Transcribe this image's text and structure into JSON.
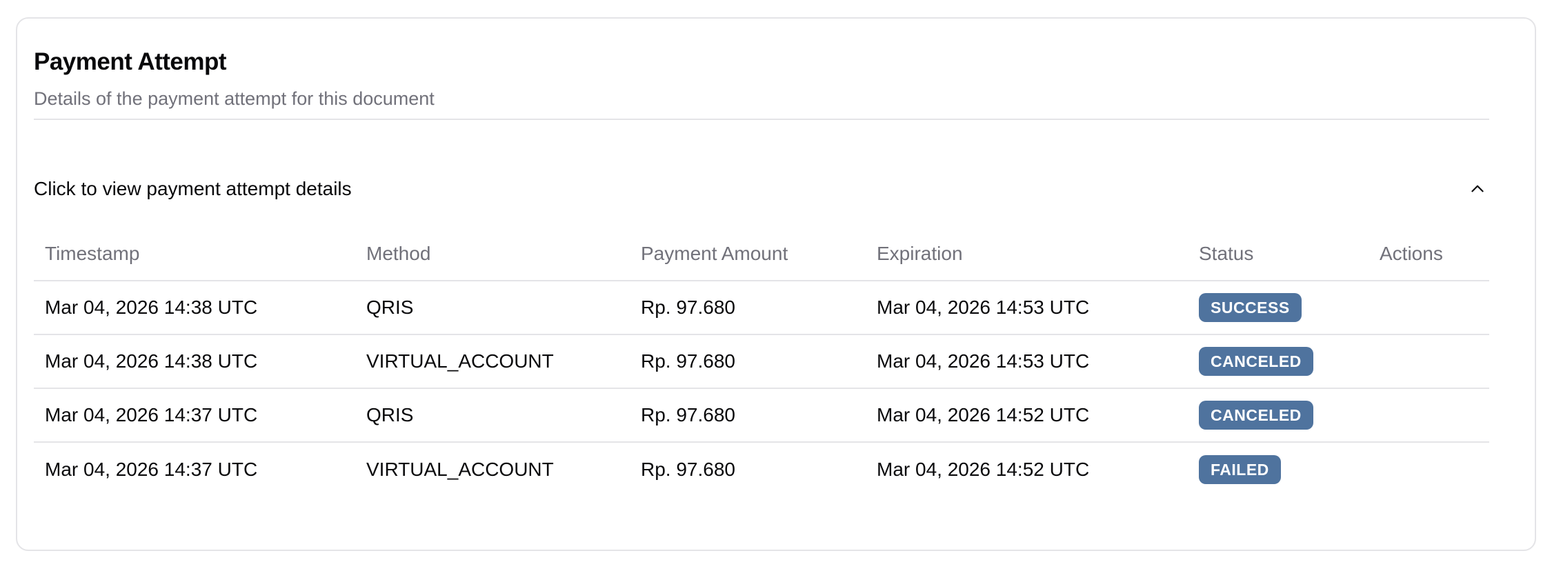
{
  "card": {
    "title": "Payment Attempt",
    "subtitle": "Details of the payment attempt for this document"
  },
  "accordion": {
    "label": "Click to view payment attempt details",
    "icon": "chevron-up-icon",
    "expanded": true
  },
  "table": {
    "headers": {
      "timestamp": "Timestamp",
      "method": "Method",
      "amount": "Payment Amount",
      "expiration": "Expiration",
      "status": "Status",
      "actions": "Actions"
    },
    "rows": [
      {
        "timestamp": "Mar 04, 2026 14:38 UTC",
        "method": "QRIS",
        "amount": "Rp. 97.680",
        "expiration": "Mar 04, 2026 14:53 UTC",
        "status": "SUCCESS"
      },
      {
        "timestamp": "Mar 04, 2026 14:38 UTC",
        "method": "VIRTUAL_ACCOUNT",
        "amount": "Rp. 97.680",
        "expiration": "Mar 04, 2026 14:53 UTC",
        "status": "CANCELED"
      },
      {
        "timestamp": "Mar 04, 2026 14:37 UTC",
        "method": "QRIS",
        "amount": "Rp. 97.680",
        "expiration": "Mar 04, 2026 14:52 UTC",
        "status": "CANCELED"
      },
      {
        "timestamp": "Mar 04, 2026 14:37 UTC",
        "method": "VIRTUAL_ACCOUNT",
        "amount": "Rp. 97.680",
        "expiration": "Mar 04, 2026 14:52 UTC",
        "status": "FAILED"
      }
    ]
  },
  "colors": {
    "badge": "#4f739e",
    "border": "#e4e4e7",
    "muted_text": "#71717a",
    "text": "#09090b"
  }
}
